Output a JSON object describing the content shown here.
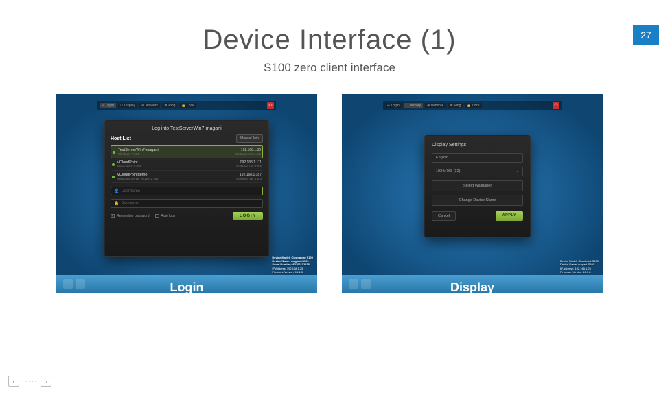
{
  "page_number": "27",
  "title": "Device Interface (1)",
  "subtitle": "S100 zero client interface",
  "topbar": {
    "items": [
      "⇨ Login",
      "☐ Display",
      "⊕ Network",
      "⌘ Ping",
      "🔒 Lock"
    ]
  },
  "login": {
    "panel_title": "Log into TestServerWin7-magani",
    "host_list_label": "Host List",
    "manual_btn": "Manual Join",
    "hosts": [
      {
        "name": "TestServerWin7-magani",
        "sub": "Windows 7 x64",
        "ip": "192.168.1.30",
        "ver": "Software Ver:1.9.5"
      },
      {
        "name": "vCloudPoint",
        "sub": "Windows 8.1 x64",
        "ip": "092.188.1.111",
        "ver": "Software Ver:2.0.5"
      },
      {
        "name": "vCloudPointdemo",
        "sub": "Windows Server 2012 R2 x64",
        "ip": "192.168.1.187",
        "ver": "Software Ver:2.0.3"
      }
    ],
    "username_ph": "Username",
    "password_ph": "Password",
    "remember": "Remember password",
    "autologin": "Auto login",
    "login_btn": "LOGIN",
    "caption": "Login"
  },
  "display": {
    "panel_title": "Display Settings",
    "lang_label": "English",
    "resolution": "1024x768 (32)",
    "wallpaper_btn": "Select Wallpaper",
    "devname_btn": "Change Device Name",
    "cancel": "Cancel",
    "apply": "APPLY",
    "caption": "Display"
  },
  "footer_info": {
    "l1": "Device Model: Cloudpoint S100",
    "l2": "Device Name: magani -S100",
    "l3": "Serial Number: A2102151128",
    "l4": "IP Address: 192.168.1.25",
    "l5": "Firmware Version: 15.1.8"
  },
  "footer_info2": {
    "l1": "Device Model: Cloudpoint S100",
    "l2": "Device Name: magani-S100",
    "l3": "IP Address: 192.168.1.25",
    "l4": "Firmware Version: 16.1.8"
  }
}
